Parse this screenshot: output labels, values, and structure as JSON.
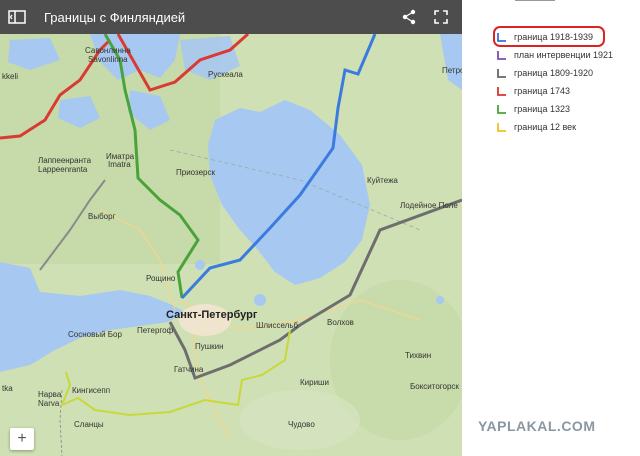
{
  "map": {
    "title": "Границы с Финляндией",
    "labels": {
      "savonlinna_ru": "Савонлинна",
      "savonlinna": "Savonlinna",
      "mikkeli": "kkeli",
      "lappeenranta_ru": "Лаппеенранта",
      "lappeenranta": "Lappeenranta",
      "imatra_ru": "Иматра",
      "imatra": "Imatra",
      "ruskeala": "Рускеала",
      "petrozavodsk": "Петроз",
      "priozersk": "Приозерск",
      "vyborg": "Выборг",
      "kuitezha": "Куйтежа",
      "lodeynoye_pole": "Лодейное Поле",
      "roshchino": "Рощино",
      "spb": "Санкт-Петербург",
      "sosnovy_bor": "Сосновый Бор",
      "petergof": "Петергоф",
      "shlisselburg": "Шлиссельб",
      "volkhov": "Волхов",
      "pushkin": "Пушкин",
      "gatchina": "Гатчина",
      "tikhvin": "Тихвин",
      "kotka": "tka",
      "narva_ru": "Нарва",
      "narva": "Narva",
      "kingisepp": "Кингисепп",
      "kirishi": "Кириши",
      "boksitogorsk": "Бокситогорск",
      "slantsy": "Сланцы",
      "chudovo": "Чудово"
    },
    "zoom_in": "+"
  },
  "legend": {
    "items": [
      {
        "label": "граница 1918-1939",
        "color": "#3b6fd6"
      },
      {
        "label": "план интервенции 1921",
        "color": "#7a4fb0"
      },
      {
        "label": "граница 1809-1920",
        "color": "#666666"
      },
      {
        "label": "граница 1743",
        "color": "#d9342b"
      },
      {
        "label": "граница 1323",
        "color": "#4aa33a"
      },
      {
        "label": "граница 12 век",
        "color": "#f0c020"
      }
    ]
  },
  "watermark": "YAPLAKAL.COM",
  "colors": {
    "blue_border": "#3b7be0",
    "red_border": "#d93a32",
    "green_border": "#4aa33a",
    "gray_border": "#6e6e6e",
    "yellow_border": "#c8d83a",
    "water": "#a7c8f0",
    "land": "#cfe0b4",
    "titlebar": "#4d4d4d"
  },
  "icons": [
    "sidebar-toggle-icon",
    "share-icon",
    "fullscreen-icon",
    "map-pin-icon"
  ]
}
